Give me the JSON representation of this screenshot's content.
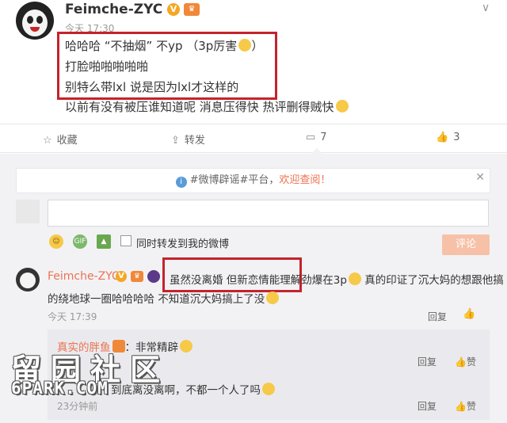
{
  "post": {
    "username": "Feimche-ZYC",
    "time": "今天 17:30",
    "lines": [
      "哈哈哈 “不抽烟” 不yp （3p厉害",
      "打脸啪啪啪啪啪",
      "别特么带lxl 说是因为lxl才这样的",
      "以前有没有被压谁知道呢  消息压得快 热评删得贼快"
    ],
    "line1_tail": "）"
  },
  "actions": {
    "favorite": "收藏",
    "repost": "转发",
    "comment_count": "7",
    "like_count": "3"
  },
  "notice": {
    "text": "#微博辟谣#平台，",
    "link": "欢迎查阅！"
  },
  "composer": {
    "repost_label": "同时转发到我的微博",
    "submit_label": "评论"
  },
  "comments": [
    {
      "username": "Feimche-ZYC",
      "text_boxed": "虽然没离婚 但新恋情能理解",
      "text_rest": "劲爆在3p",
      "text_rest2": " 真的印证了沉大妈的想跟他搞",
      "text_line2": "的绕地球一圈哈哈哈哈 不知道沉大妈搞上了没",
      "time": "今天 17:39",
      "reply": "回复"
    }
  ],
  "replies": [
    {
      "username": "真实的胖鱼",
      "text": "：非常精辟",
      "reply": "回复",
      "like": "赞"
    },
    {
      "username": "",
      "text": "到底离没离啊，不都一个人了吗",
      "time": "23分钟前",
      "reply": "回复",
      "like": "赞"
    }
  ],
  "watermark": {
    "line1": "留园社区",
    "line2": "6PARK.COM"
  },
  "colors": {
    "highlight_box": "#c4232c",
    "link": "#eb7350",
    "badge_v": "#f5a623"
  },
  "icons": [
    "avatar",
    "v-badge",
    "chevron-down-icon",
    "star-icon",
    "repost-icon",
    "comment-icon",
    "like-icon",
    "info-icon",
    "close-icon",
    "emoji-icon",
    "gif-icon",
    "image-icon"
  ]
}
